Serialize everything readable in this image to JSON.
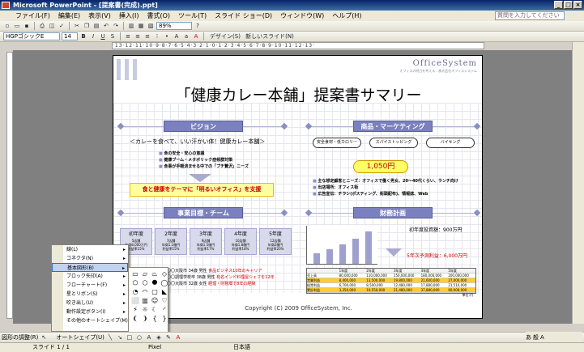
{
  "window": {
    "title": "Microsoft PowerPoint - [提案書(完成).ppt]",
    "btn_min": "_",
    "btn_max": "□",
    "btn_close": "×"
  },
  "menu": [
    "ファイル(F)",
    "編集(E)",
    "表示(V)",
    "挿入(I)",
    "書式(O)",
    "ツール(T)",
    "スライド ショー(D)",
    "ウィンドウ(W)",
    "ヘルプ(H)"
  ],
  "help_placeholder": "質問を入力してください",
  "toolbar1": {
    "zoom": "89%"
  },
  "toolbar2": {
    "font": "HGPゴシックE",
    "size": "14",
    "design": "デザイン(S)",
    "new_slide": "新しいスライド(N)"
  },
  "ruler": "·13·12·11·10·9·8·7·6·5·4·3·2·1·0·1·2·3·4·5·6·7·8·9·10·11·12·13·",
  "slide": {
    "logo": "OfficeSystem",
    "logo_sub": "オフィスの明日を考える…株式会社オフィスシステム",
    "title": "「健康カレー本舗」提案書サマリー",
    "vision": {
      "header": "ビジョン",
      "tagline": "＜カレーを食べて、いい汗かい体！健康カレー本舗＞",
      "bullets": [
        "食の安全・安心の意識",
        "健康ブーム・メタボリック症候群対策",
        "食事が手軽済ませる中での「プチ贅沢」ニーズ"
      ],
      "goal": "食と健康をテーマに「明るいオフィス」を支援"
    },
    "marketing": {
      "header": "商品・マーケティング",
      "pills": [
        "安全食材・低カロリー",
        "スパイストッピング",
        "バイキング"
      ],
      "price": "1,050円",
      "bullets": [
        "主な想定顧客とニーズ：オフィスで働く男女、20～40代くらい、ランチ向け",
        "出店場所：オフィス街",
        "広告宣伝：チラシ(ポスティング、街頭配布)、情報誌、Web"
      ]
    },
    "goals": {
      "header": "事業目標・チーム",
      "years": [
        {
          "label": "初年度",
          "sub": "5店舗\n年商8,000万円\n利益率15%"
        },
        {
          "label": "2年度",
          "sub": "7店舗\n年商1.1億円\n利益率15%"
        },
        {
          "label": "3年度",
          "sub": "9店舗\n年商1.5億円\n利益率17%"
        },
        {
          "label": "4年度",
          "sub": "10店舗\n年商1.8億円\n利益率18%"
        },
        {
          "label": "5年度",
          "sub": "12店舗\n年商2億円\n利益率20%"
        }
      ],
      "team": [
        {
          "line": "〇〇大阪市 34歳 男性",
          "red": "食品ビジネス10年のキャリア"
        },
        {
          "line": "〇〇調理学校卒 38歳 男性",
          "red": "有名インド料理屋シェフを12年"
        },
        {
          "line": "〇〇大阪市 32歳 女性",
          "red": "経理・財務畑で8年の経験"
        }
      ]
    },
    "finance": {
      "header": "財務計画",
      "investment": "初年度投資額：900万円",
      "cumulative": "5年次予測利益：6,000万円",
      "bar_values": [
        0.3,
        0.4,
        0.55,
        0.7,
        0.9
      ],
      "table": {
        "headers": [
          "",
          "1年度",
          "2年度",
          "3年度",
          "4年度",
          "5年度"
        ],
        "rows": [
          [
            "売上高",
            "80,000,000",
            "110,000,000",
            "150,000,000",
            "180,000,000",
            "200,000,000"
          ],
          [
            "営業利益",
            "8,400,000",
            "13,500,000",
            "19,800,000",
            "21,600,000",
            "27,000,000"
          ],
          [
            "経常利益",
            "6,700,000",
            "8,500,000",
            "12,480,000",
            "17,880,000",
            "21,510,000"
          ],
          [
            "累計利益",
            "3,350,000",
            "10,550,000",
            "21,480,000",
            "37,880,000",
            "60,000,000"
          ]
        ],
        "unit": "単位:円"
      }
    },
    "copyright": "Copyright (C) 2009 OfficeSystem, Inc."
  },
  "autoshape_menu": [
    "線(L)",
    "コネクタ(N)",
    "基本図形(B)",
    "ブロック矢印(A)",
    "フローチャート(F)",
    "星とリボン(S)",
    "吹き出し(U)",
    "動作設定ボタン(I)",
    "その他のオートシェイプ(M)"
  ],
  "basic_shapes": [
    "▭",
    "▱",
    "⏢",
    "◇",
    "⬠",
    "⬡",
    "⯃",
    "◯",
    "◔",
    "◠",
    "▢",
    "◣",
    "⬜",
    "▥",
    "☺",
    "♡",
    "⚡",
    "☼",
    "☾",
    "◜",
    "❨",
    "❩",
    "{",
    "}"
  ],
  "drawbar": {
    "draw": "図形の調整(R)",
    "autoshape": "オートシェイプ(U)"
  },
  "status": {
    "slide": "スライド 1 / 1",
    "design": "Pixel",
    "lang": "日本語"
  },
  "ime": [
    "あ",
    "般",
    "A"
  ]
}
